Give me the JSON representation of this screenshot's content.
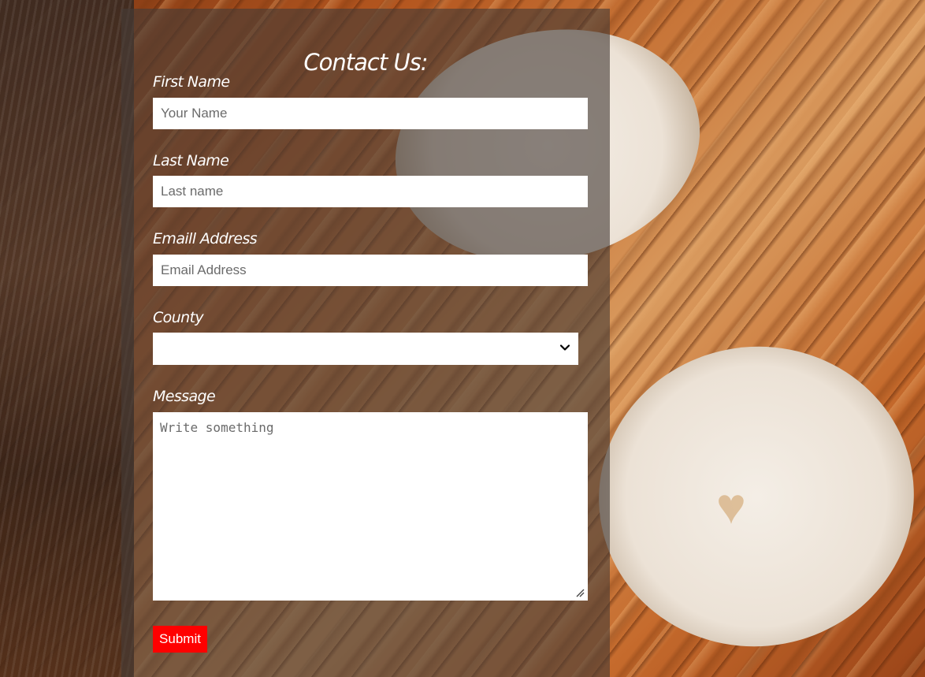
{
  "form": {
    "title": "Contact Us:",
    "first_name": {
      "label": "First Name",
      "placeholder": "Your Name",
      "value": ""
    },
    "last_name": {
      "label": "Last Name",
      "placeholder": "Last name",
      "value": ""
    },
    "email": {
      "label": "Emaill Address",
      "placeholder": "Email Address",
      "value": ""
    },
    "county": {
      "label": "County",
      "selected": ""
    },
    "message": {
      "label": "Message",
      "placeholder": "Write something",
      "value": ""
    },
    "submit_label": "Submit"
  },
  "icons": {
    "select_arrow": "chevron-down-icon",
    "resize_handle": "resize-grip-icon"
  },
  "colors": {
    "submit_background": "#ff0000",
    "panel_overlay": "rgba(70,60,55,0.62)"
  }
}
